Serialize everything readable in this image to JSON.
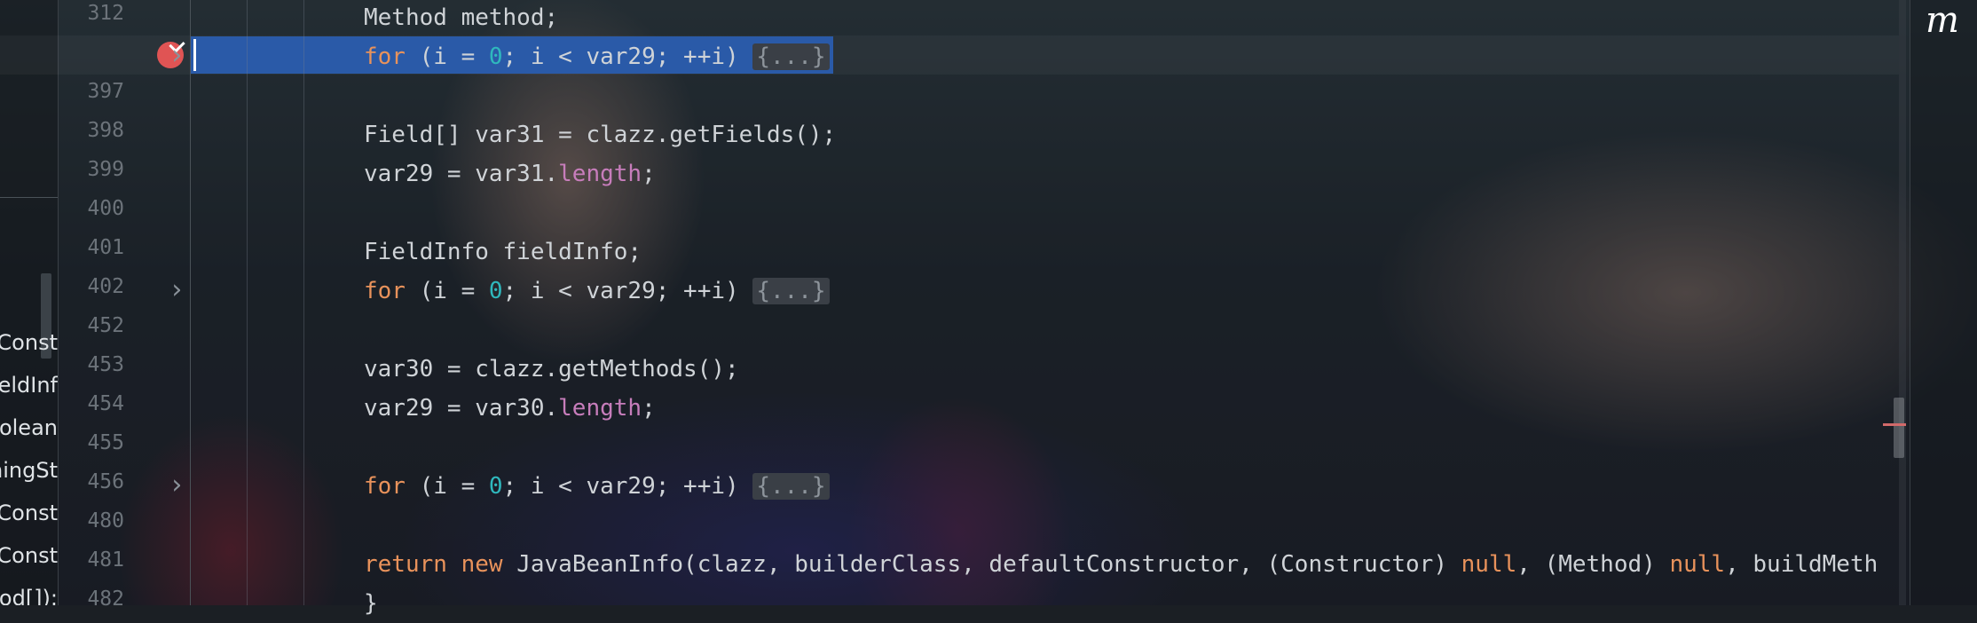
{
  "app": {
    "logo": "m",
    "accent": "#2a5aa8",
    "breakpoint_color": "#e05454"
  },
  "left_panel": {
    "items": [
      {
        "label": "Const"
      },
      {
        "label": "eldInf"
      },
      {
        "label": "olean"
      },
      {
        "label": "ningSt"
      },
      {
        "label": "Const"
      },
      {
        "label": "Const"
      },
      {
        "label": "nod[]):"
      }
    ]
  },
  "editor": {
    "lines": [
      {
        "no": "312",
        "tokens": [
          {
            "t": "Method method;",
            "c": ""
          }
        ]
      },
      {
        "no": "",
        "tokens": [
          {
            "t": "for",
            "c": "kw"
          },
          {
            "t": " (i = ",
            "c": ""
          },
          {
            "t": "0",
            "c": "num"
          },
          {
            "t": "; i < var29; ++i) ",
            "c": ""
          },
          {
            "t": "{...}",
            "c": "fold-marker"
          }
        ]
      },
      {
        "no": "397",
        "tokens": []
      },
      {
        "no": "398",
        "tokens": [
          {
            "t": "Field[] var31 = clazz.getFields();",
            "c": ""
          }
        ]
      },
      {
        "no": "399",
        "tokens": [
          {
            "t": "var29 = var31.",
            "c": ""
          },
          {
            "t": "length",
            "c": "fld"
          },
          {
            "t": ";",
            "c": ""
          }
        ]
      },
      {
        "no": "400",
        "tokens": []
      },
      {
        "no": "401",
        "tokens": [
          {
            "t": "FieldInfo fieldInfo;",
            "c": ""
          }
        ]
      },
      {
        "no": "402",
        "tokens": [
          {
            "t": "for",
            "c": "kw"
          },
          {
            "t": " (i = ",
            "c": ""
          },
          {
            "t": "0",
            "c": "num"
          },
          {
            "t": "; i < var29; ++i) ",
            "c": ""
          },
          {
            "t": "{...}",
            "c": "fold-marker"
          }
        ]
      },
      {
        "no": "452",
        "tokens": []
      },
      {
        "no": "453",
        "tokens": [
          {
            "t": "var30 = clazz.getMethods();",
            "c": ""
          }
        ]
      },
      {
        "no": "454",
        "tokens": [
          {
            "t": "var29 = var30.",
            "c": ""
          },
          {
            "t": "length",
            "c": "fld"
          },
          {
            "t": ";",
            "c": ""
          }
        ]
      },
      {
        "no": "455",
        "tokens": []
      },
      {
        "no": "456",
        "tokens": [
          {
            "t": "for",
            "c": "kw"
          },
          {
            "t": " (i = ",
            "c": ""
          },
          {
            "t": "0",
            "c": "num"
          },
          {
            "t": "; i < var29; ++i) ",
            "c": ""
          },
          {
            "t": "{...}",
            "c": "fold-marker"
          }
        ]
      },
      {
        "no": "480",
        "tokens": []
      },
      {
        "no": "481",
        "tokens": [
          {
            "t": "return new",
            "c": "kw"
          },
          {
            "t": " JavaBeanInfo(clazz, builderClass, defaultConstructor, (Constructor) ",
            "c": ""
          },
          {
            "t": "null",
            "c": "kw"
          },
          {
            "t": ", (Method) ",
            "c": ""
          },
          {
            "t": "null",
            "c": "kw"
          },
          {
            "t": ", buildMeth",
            "c": ""
          }
        ]
      },
      {
        "no": "482",
        "tokens": [
          {
            "t": "}",
            "c": ""
          }
        ]
      }
    ],
    "folded_lines": [
      "",
      "402",
      "456"
    ]
  }
}
